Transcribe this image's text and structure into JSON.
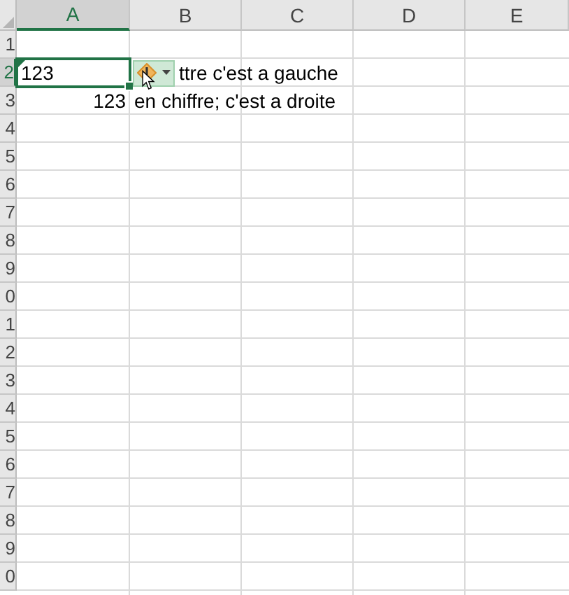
{
  "columns": [
    {
      "label": "A",
      "selected": true
    },
    {
      "label": "B",
      "selected": false
    },
    {
      "label": "C",
      "selected": false
    },
    {
      "label": "D",
      "selected": false
    },
    {
      "label": "E",
      "selected": false
    }
  ],
  "rows": [
    {
      "label": "1",
      "selected": false
    },
    {
      "label": "2",
      "selected": true,
      "cells": [
        {
          "kind": "text",
          "text": "123",
          "selected": true,
          "error_flag": true
        },
        {
          "kind": "smart_tag",
          "text": "ttre c'est a gauche"
        }
      ]
    },
    {
      "label": "3",
      "selected": false,
      "cells": [
        {
          "kind": "number",
          "text": "123"
        },
        {
          "kind": "text",
          "text": "en chiffre; c'est a droite"
        }
      ]
    },
    {
      "label": "4",
      "selected": false
    },
    {
      "label": "5",
      "selected": false
    },
    {
      "label": "6",
      "selected": false
    },
    {
      "label": "7",
      "selected": false
    },
    {
      "label": "8",
      "selected": false
    },
    {
      "label": "9",
      "selected": false
    },
    {
      "label": "0",
      "selected": false
    },
    {
      "label": "1",
      "selected": false
    },
    {
      "label": "2",
      "selected": false
    },
    {
      "label": "3",
      "selected": false
    },
    {
      "label": "4",
      "selected": false
    },
    {
      "label": "5",
      "selected": false
    },
    {
      "label": "6",
      "selected": false
    },
    {
      "label": "7",
      "selected": false
    },
    {
      "label": "8",
      "selected": false
    },
    {
      "label": "9",
      "selected": false
    },
    {
      "label": "0",
      "selected": false
    }
  ]
}
